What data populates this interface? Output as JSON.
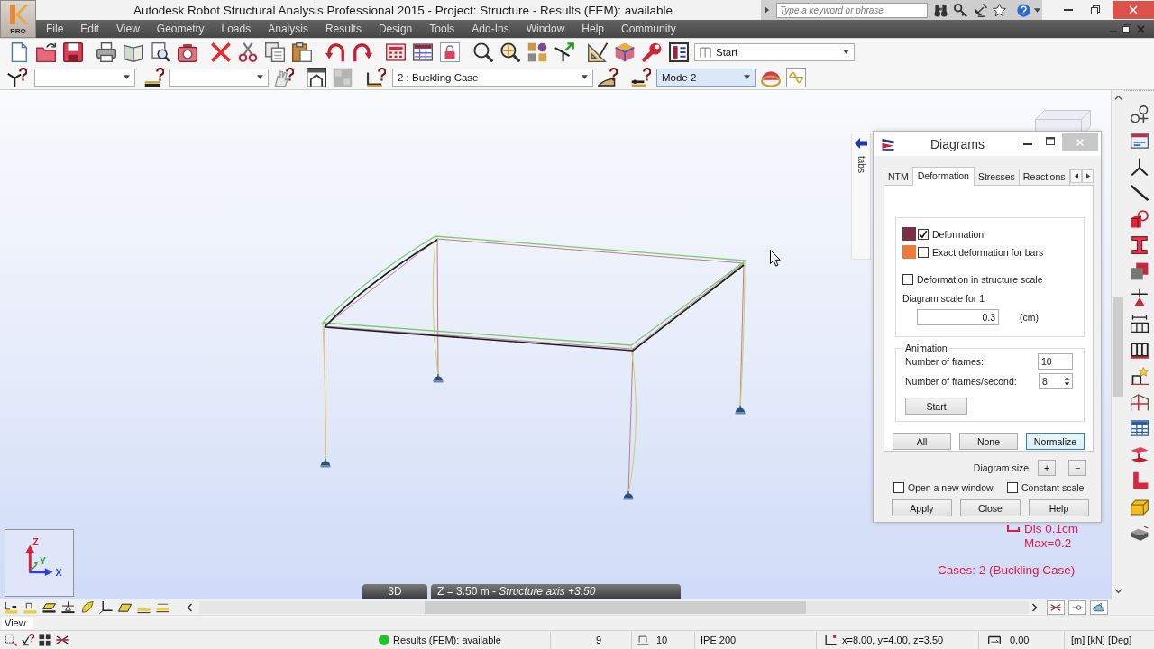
{
  "window": {
    "title": "Autodesk Robot Structural Analysis Professional 2015 - Project: Structure - Results (FEM): available",
    "logo_badge": "PRO",
    "search": {
      "placeholder": "Type a keyword or phrase"
    }
  },
  "menu": [
    "File",
    "Edit",
    "View",
    "Geometry",
    "Loads",
    "Analysis",
    "Results",
    "Design",
    "Tools",
    "Add-Ins",
    "Window",
    "Help",
    "Community"
  ],
  "toolbar_1": {
    "buttons": [
      {
        "pressed": false
      },
      {
        "pressed": false
      },
      {
        "pressed": false
      },
      {
        "pressed": false
      },
      {
        "pressed": false
      },
      {
        "pressed": false
      },
      {
        "pressed": false
      },
      {
        "pressed": false
      },
      {
        "pressed": false
      },
      {
        "pressed": false
      },
      {
        "pressed": false
      },
      {
        "pressed": false
      },
      {
        "pressed": false
      },
      {
        "pressed": false
      },
      {
        "pressed": false
      },
      {
        "pressed": true
      },
      {
        "pressed": false
      },
      {
        "pressed": false
      },
      {
        "pressed": false
      },
      {
        "pressed": false
      },
      {
        "pressed": false
      },
      {
        "pressed": false
      },
      {
        "pressed": false
      },
      {
        "pressed": false
      }
    ],
    "layout_dropdown": "Start"
  },
  "toolbar_2": {
    "buttons": [
      {
        "pressed": false
      },
      {
        "pressed": false
      },
      {
        "pressed": false
      },
      {
        "pressed": false
      },
      {
        "pressed": false
      },
      {
        "pressed": false
      },
      {
        "pressed": false
      },
      {
        "pressed": false
      },
      {
        "pressed": false
      },
      {
        "pressed": true
      }
    ],
    "case_dropdown": "2 : Buckling Case",
    "mode_dropdown": {
      "value": "Mode 2",
      "focused": true
    }
  },
  "viewport": {
    "side_tab": "tabs",
    "legend": [
      "Dis 0.1cm",
      "Max=0.2"
    ],
    "cases": "Cases: 2 (Buckling Case)",
    "axis_labels": [
      "Z",
      "Y",
      "X"
    ],
    "view_tab": "3D",
    "plane_tab": "Z = 3.50 m - *Structure axis +3.50*"
  },
  "diagrams": {
    "title": "Diagrams",
    "tabs": [
      {
        "label": "NTM",
        "selected": false
      },
      {
        "label": "Deformation",
        "selected": true
      },
      {
        "label": "Stresses",
        "selected": false
      },
      {
        "label": "Reactions",
        "selected": false
      }
    ],
    "options": [
      {
        "kind": "swatch",
        "label": "Deformation",
        "color": "#7a2f42",
        "checked": true
      },
      {
        "kind": "swatch",
        "label": "Exact deformation for bars",
        "color": "#ee7a3c",
        "checked": false
      },
      {
        "kind": "plain",
        "label": "Deformation in structure scale",
        "checked": false
      }
    ],
    "scale_label": "Diagram scale for 1",
    "scale_value": "0.3",
    "scale_unit": "(cm)",
    "animation": {
      "title": "Animation",
      "frames_label": "Number of frames:",
      "frames_value": "10",
      "fps_label": "Number of frames/second:",
      "fps_value": "8",
      "start_button": "Start"
    },
    "select_buttons": [
      {
        "label": "All",
        "focused": false
      },
      {
        "label": "None",
        "focused": false
      },
      {
        "label": "Normalize",
        "focused": true
      }
    ],
    "size_label": "Diagram size:",
    "size_buttons": [
      "+",
      "−"
    ],
    "footer_options": [
      {
        "label": "Open a new window",
        "checked": false
      },
      {
        "label": "Constant scale",
        "checked": false
      }
    ],
    "buttons": [
      "Apply",
      "Close",
      "Help"
    ]
  },
  "view_label": "View",
  "status_bar": {
    "message": "Results (FEM): available",
    "selected_count": "9",
    "bar_count": "10",
    "section": "IPE 200",
    "coordinates": "x=8.00, y=4.00, z=3.50",
    "angle": "0.00",
    "units": "[m] [kN] [Deg]"
  }
}
